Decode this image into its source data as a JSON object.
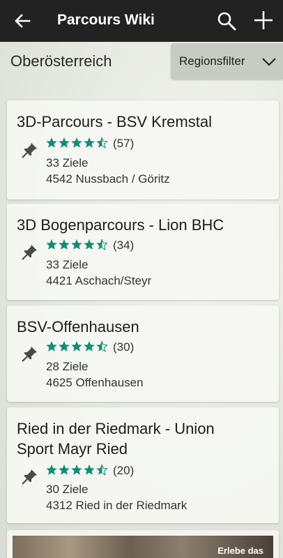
{
  "app_bar": {
    "title": "Parcours Wiki",
    "icons": [
      "back-arrow-icon",
      "search-icon",
      "plus-icon"
    ]
  },
  "region": {
    "title": "Oberösterreich",
    "filter_label": "Regionsfilter"
  },
  "rating_color": "#138d75",
  "parcours": [
    {
      "name": "3D-Parcours - BSV Kremstal",
      "rating": 4.5,
      "reviews": "(57)",
      "targets": "33 Ziele",
      "address": "4542 Nussbach / Göritz"
    },
    {
      "name": "3D Bogenparcours - Lion BHC",
      "rating": 4.5,
      "reviews": "(34)",
      "targets": "33 Ziele",
      "address": "4421 Aschach/Steyr"
    },
    {
      "name": "BSV-Offenhausen",
      "rating": 4.5,
      "reviews": "(30)",
      "targets": "28 Ziele",
      "address": "4625 Offenhausen"
    },
    {
      "name_line1": "Ried in der Riedmark - Union",
      "name_line2": "Sport Mayr Ried",
      "rating": 4.5,
      "reviews": "(20)",
      "targets": "30 Ziele",
      "address": "4312 Ried in der Riedmark"
    }
  ],
  "banner": {
    "cta": "Erlebe das"
  }
}
